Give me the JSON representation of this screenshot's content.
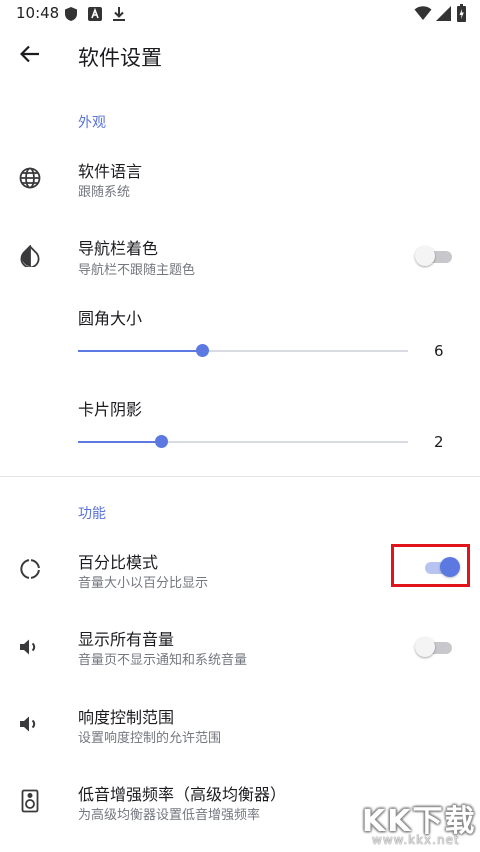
{
  "status_bar": {
    "time": "10:48",
    "left_icons": [
      "shield-icon",
      "a-badge-icon",
      "download-icon"
    ],
    "right_icons": [
      "wifi-icon",
      "signal-icon",
      "battery-icon"
    ]
  },
  "app_bar": {
    "back_icon": "arrow-left-icon",
    "title": "软件设置"
  },
  "colors": {
    "accent": "#5b79e0",
    "highlight": "#e0141b",
    "section": "#5a74d8"
  },
  "appearance": {
    "header": "外观",
    "language": {
      "icon": "globe-icon",
      "title": "软件语言",
      "subtitle": "跟随系统"
    },
    "navbar_tint": {
      "icon": "contrast-icon",
      "title": "导航栏着色",
      "subtitle": "导航栏不跟随主题色",
      "enabled": false
    },
    "corner_radius": {
      "title": "圆角大小",
      "value": "6",
      "fraction": 0.375
    },
    "card_shadow": {
      "title": "卡片阴影",
      "value": "2",
      "fraction": 0.25
    }
  },
  "features": {
    "header": "功能",
    "percent_mode": {
      "icon": "circle-progress-icon",
      "title": "百分比模式",
      "subtitle": "音量大小以百分比显示",
      "enabled": true
    },
    "show_all_volumes": {
      "icon": "volume-icon",
      "title": "显示所有音量",
      "subtitle": "音量页不显示通知和系统音量",
      "enabled": false
    },
    "loudness_range": {
      "icon": "volume-icon",
      "title": "响度控制范围",
      "subtitle": "设置响度控制的允许范围"
    },
    "bass_boost": {
      "icon": "speaker-icon",
      "title": "低音增强频率（高级均衡器）",
      "subtitle": "为高级均衡器设置低音增强频率"
    }
  },
  "watermark": {
    "logo": "KK下载",
    "url": "www.kkx.net"
  }
}
